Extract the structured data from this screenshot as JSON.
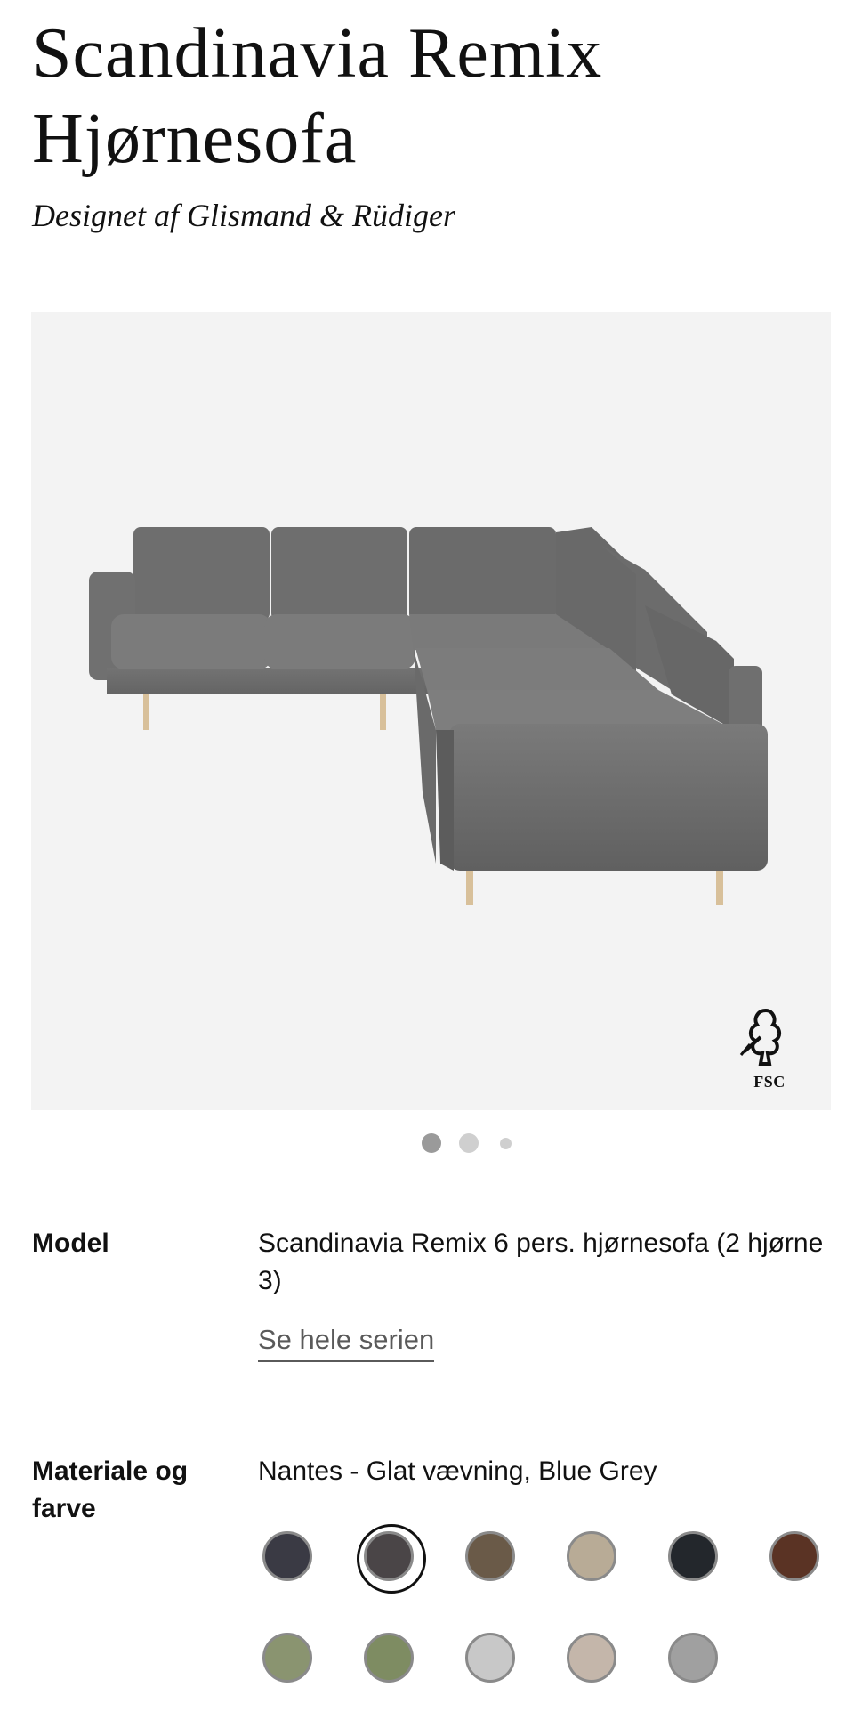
{
  "product": {
    "title": "Scandinavia Remix Hjørnesofa",
    "designer": "Designet af Glismand & Rüdiger"
  },
  "gallery": {
    "image_alt": "grey-corner-sofa",
    "badge_text": "FSC",
    "slide_count": 3,
    "active_slide": 1
  },
  "model": {
    "label": "Model",
    "value": "Scandinavia Remix 6 pers. hjørnesofa (2 hjørne 3)",
    "link": "Se hele serien"
  },
  "material": {
    "label": "Materiale og farve",
    "value": "Nantes - Glat vævning, Blue Grey",
    "selected_index": 1,
    "swatches": [
      {
        "color": "#3a3a44"
      },
      {
        "color": "#4a4547"
      },
      {
        "color": "#6a5a48"
      },
      {
        "color": "#b8ab96"
      },
      {
        "color": "#23272c"
      },
      {
        "color": "#5a3324"
      },
      {
        "color": "#8a9470"
      },
      {
        "color": "#7e8c62"
      },
      {
        "color": "#c8c8c8"
      },
      {
        "color": "#c4b6aa"
      },
      {
        "color": "#a0a0a0"
      }
    ]
  }
}
